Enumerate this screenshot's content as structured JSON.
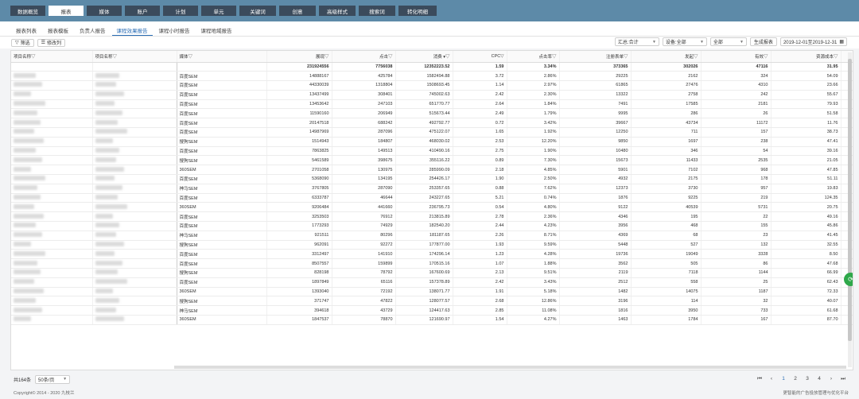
{
  "nav": [
    "数据概览",
    "报表",
    "媒体",
    "账户",
    "计划",
    "单元",
    "关键词",
    "创意",
    "高级样式",
    "搜索词",
    "转化明细"
  ],
  "subtabs": [
    "报表列表",
    "报表模板",
    "负责人报告",
    "课程效果报告",
    "课程小时报告",
    "课程地域报告"
  ],
  "toolbar": {
    "filter_label": "筛选",
    "columns_label": "修改列",
    "agg_select": "汇总:合计",
    "device_select": "设备:全部",
    "scope_select": "全部",
    "generate_label": "生成报表",
    "date_range": "2019-12-01至2019-12-31"
  },
  "columns": [
    {
      "label": "项目名称",
      "align": "txt"
    },
    {
      "label": "项目名称",
      "align": "txt"
    },
    {
      "label": "媒体",
      "align": "txt"
    },
    {
      "label": "展现",
      "align": "num"
    },
    {
      "label": "点击",
      "align": "num"
    },
    {
      "label": "消费 ▾",
      "align": "num"
    },
    {
      "label": "CPC",
      "align": "num"
    },
    {
      "label": "点击率",
      "align": "num"
    },
    {
      "label": "注册表单",
      "align": "num"
    },
    {
      "label": "发起",
      "align": "num"
    },
    {
      "label": "有效",
      "align": "num"
    },
    {
      "label": "资源成本",
      "align": "num"
    },
    {
      "label": "同销率",
      "align": "num"
    }
  ],
  "summary": [
    "",
    "",
    "",
    "231924556",
    "7756038",
    "12352223.52",
    "1.59",
    "3.34%",
    "373365",
    "302026",
    "47116",
    "31.95",
    "4.99%"
  ],
  "rows": [
    [
      "百度SEM",
      "14888167",
      "425784",
      "1582494.88",
      "3.72",
      "2.86%",
      "29225",
      "2162",
      "324",
      "54.09",
      "6.87%"
    ],
    [
      "百度SEM",
      "44330039",
      "1318804",
      "1508693.45",
      "1.14",
      "2.97%",
      "61865",
      "27476",
      "4310",
      "23.66",
      "4.84%"
    ],
    [
      "百度SEM",
      "13437499",
      "308401",
      "745002.63",
      "2.42",
      "2.30%",
      "13322",
      "2758",
      "242",
      "55.67",
      "4.34%"
    ],
    [
      "百度SEM",
      "13453642",
      "247103",
      "651770.77",
      "2.64",
      "1.84%",
      "7491",
      "17585",
      "2181",
      "79.93",
      "3.30%"
    ],
    [
      "百度SEM",
      "11590160",
      "206949",
      "515673.44",
      "2.49",
      "1.79%",
      "9995",
      "286",
      "26",
      "51.58",
      "4.83%"
    ],
    [
      "百度SEM",
      "20147518",
      "688242",
      "492792.77",
      "0.72",
      "3.42%",
      "39667",
      "43734",
      "11172",
      "11.76",
      "6.09%"
    ],
    [
      "百度SEM",
      "14987969",
      "287096",
      "475122.07",
      "1.65",
      "1.92%",
      "12250",
      "711",
      "157",
      "38.73",
      "4.27%"
    ],
    [
      "搜狗SEM",
      "1514943",
      "184807",
      "468030.02",
      "2.53",
      "12.20%",
      "9850",
      "1697",
      "238",
      "47.41",
      "5.34%"
    ],
    [
      "百度SEM",
      "7863825",
      "149513",
      "410490.16",
      "2.75",
      "1.90%",
      "10480",
      "346",
      "54",
      "39.16",
      "7.01%"
    ],
    [
      "搜狗SEM",
      "5461589",
      "398675",
      "355116.22",
      "0.89",
      "7.30%",
      "15673",
      "11433",
      "2535",
      "21.05",
      "4.23%"
    ],
    [
      "360SEM",
      "2701058",
      "130975",
      "285990.09",
      "2.18",
      "4.85%",
      "5901",
      "7102",
      "968",
      "47.85",
      "4.56%"
    ],
    [
      "百度SEM",
      "5368090",
      "134195",
      "254426.17",
      "1.90",
      "2.50%",
      "4932",
      "2175",
      "178",
      "51.11",
      "3.71%"
    ],
    [
      "神马SEM",
      "3767805",
      "287090",
      "253357.65",
      "0.88",
      "7.62%",
      "12373",
      "3730",
      "957",
      "19.83",
      "4.45%"
    ],
    [
      "百度SEM",
      "6333787",
      "46644",
      "243227.65",
      "5.21",
      "0.74%",
      "1876",
      "9225",
      "219",
      "124.35",
      "4.19%"
    ],
    [
      "360SEM",
      "9206484",
      "441660",
      "236795.73",
      "0.54",
      "4.80%",
      "9122",
      "40539",
      "5731",
      "20.75",
      "2.58%"
    ],
    [
      "百度SEM",
      "3253503",
      "76912",
      "213815.89",
      "2.78",
      "2.36%",
      "4346",
      "195",
      "22",
      "49.16",
      "5.65%"
    ],
    [
      "百度SEM",
      "1773293",
      "74929",
      "182540.20",
      "2.44",
      "4.23%",
      "3956",
      "468",
      "155",
      "45.86",
      "5.31%"
    ],
    [
      "神马SEM",
      "921511",
      "80296",
      "181187.65",
      "2.26",
      "8.71%",
      "4369",
      "68",
      "23",
      "41.45",
      "5.44%"
    ],
    [
      "搜狗SEM",
      "962091",
      "92272",
      "177877.00",
      "1.93",
      "9.59%",
      "5448",
      "527",
      "132",
      "32.55",
      "5.92%"
    ],
    [
      "百度SEM",
      "3312497",
      "141910",
      "174296.14",
      "1.23",
      "4.28%",
      "19736",
      "19049",
      "3328",
      "8.50",
      "14.46%"
    ],
    [
      "百度SEM",
      "8507557",
      "159899",
      "170515.16",
      "1.07",
      "1.88%",
      "3562",
      "505",
      "86",
      "47.68",
      "2.24%"
    ],
    [
      "搜狗SEM",
      "828198",
      "78792",
      "167600.69",
      "2.13",
      "9.51%",
      "2119",
      "7118",
      "1144",
      "66.99",
      "3.18%"
    ],
    [
      "百度SEM",
      "1897849",
      "65116",
      "157378.89",
      "2.42",
      "3.43%",
      "2512",
      "558",
      "25",
      "62.43",
      "3.87%"
    ],
    [
      "360SEM",
      "1393040",
      "72192",
      "138071.77",
      "1.91",
      "5.18%",
      "1482",
      "14075",
      "1187",
      "72.33",
      "2.64%"
    ],
    [
      "搜狗SEM",
      "371747",
      "47822",
      "128077.57",
      "2.68",
      "12.86%",
      "3196",
      "114",
      "32",
      "40.07",
      "6.66%"
    ],
    [
      "神马SEM",
      "394618",
      "43729",
      "124417.63",
      "2.85",
      "11.08%",
      "1816",
      "3950",
      "733",
      "61.68",
      "4.61%"
    ],
    [
      "360SEM",
      "1847537",
      "78870",
      "121690.97",
      "1.54",
      "4.27%",
      "1463",
      "1784",
      "167",
      "87.70",
      "6.91%"
    ]
  ],
  "pager": {
    "total": "共164条",
    "page_size": "50条/页",
    "pages": [
      "1",
      "2",
      "3",
      "4"
    ],
    "current": "1"
  },
  "footer": {
    "copyright": "Copyright© 2014 - 2020 九枝兰",
    "tagline": "更智能的广告投放管理与优化平台"
  }
}
